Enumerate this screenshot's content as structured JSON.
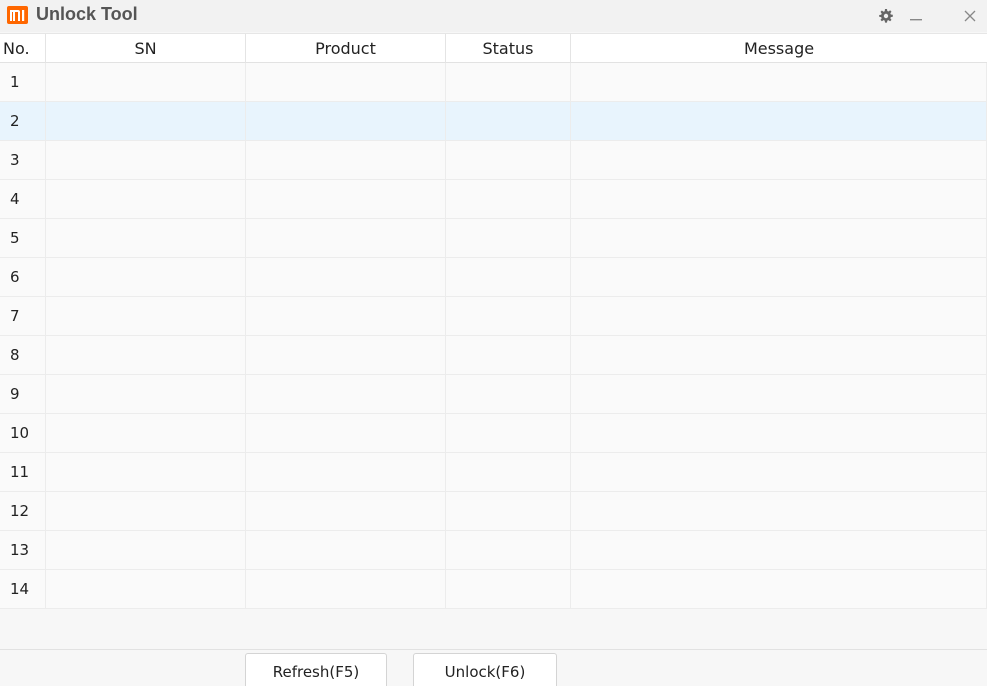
{
  "window": {
    "title": "Unlock Tool",
    "logo_icon": "mi-logo-icon",
    "brand_color": "#ff6700",
    "controls": [
      "gear-icon",
      "minimize-icon",
      "close-icon"
    ]
  },
  "table": {
    "columns": {
      "no": "No.",
      "sn": "SN",
      "product": "Product",
      "status": "Status",
      "message": "Message"
    },
    "rows": [
      {
        "no": "1",
        "sn": "",
        "product": "",
        "status": "",
        "message": ""
      },
      {
        "no": "2",
        "sn": "",
        "product": "",
        "status": "",
        "message": ""
      },
      {
        "no": "3",
        "sn": "",
        "product": "",
        "status": "",
        "message": ""
      },
      {
        "no": "4",
        "sn": "",
        "product": "",
        "status": "",
        "message": ""
      },
      {
        "no": "5",
        "sn": "",
        "product": "",
        "status": "",
        "message": ""
      },
      {
        "no": "6",
        "sn": "",
        "product": "",
        "status": "",
        "message": ""
      },
      {
        "no": "7",
        "sn": "",
        "product": "",
        "status": "",
        "message": ""
      },
      {
        "no": "8",
        "sn": "",
        "product": "",
        "status": "",
        "message": ""
      },
      {
        "no": "9",
        "sn": "",
        "product": "",
        "status": "",
        "message": ""
      },
      {
        "no": "10",
        "sn": "",
        "product": "",
        "status": "",
        "message": ""
      },
      {
        "no": "11",
        "sn": "",
        "product": "",
        "status": "",
        "message": ""
      },
      {
        "no": "12",
        "sn": "",
        "product": "",
        "status": "",
        "message": ""
      },
      {
        "no": "13",
        "sn": "",
        "product": "",
        "status": "",
        "message": ""
      },
      {
        "no": "14",
        "sn": "",
        "product": "",
        "status": "",
        "message": ""
      }
    ],
    "selected_row": "2",
    "selected_row_color": "#e8f4fd"
  },
  "buttons": {
    "refresh_label": "Refresh(F5)",
    "unlock_label": "Unlock(F6)"
  }
}
